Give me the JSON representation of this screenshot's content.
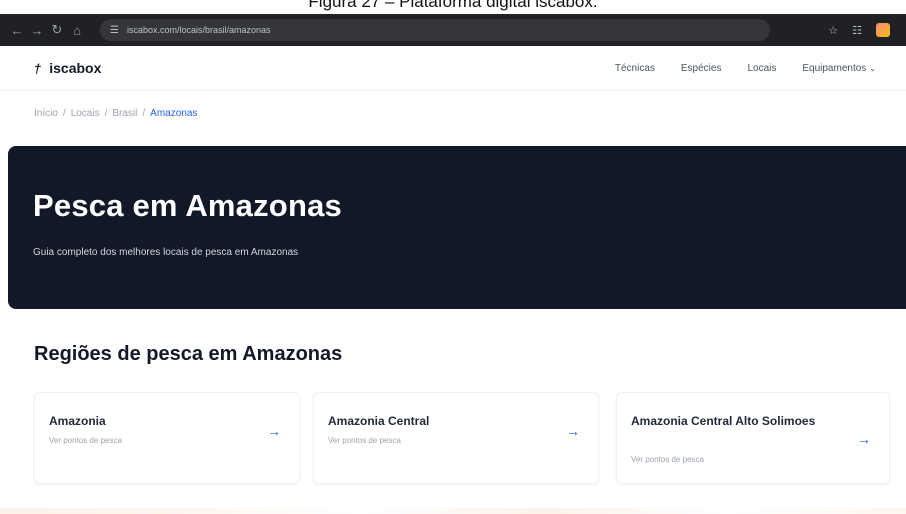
{
  "caption": "Figura 27 – Plataforma digital iscabox.",
  "browser": {
    "nav_icons": [
      "arrow-left",
      "arrow-right",
      "reload",
      "home"
    ],
    "url": "iscabox.com/locais/brasil/amazonas"
  },
  "header": {
    "logo_text": "iscabox",
    "menu": [
      "Técnicas",
      "Espécies",
      "Locais",
      "Equipamentos"
    ]
  },
  "breadcrumb": {
    "items": [
      "Início",
      "Locais",
      "Brasil",
      "Amazonas"
    ],
    "separator": "/"
  },
  "hero": {
    "title": "Pesca em Amazonas",
    "subtitle": "Guia completo dos melhores locais de pesca em Amazonas"
  },
  "regions": {
    "title": "Regiões de pesca em Amazonas",
    "cards": [
      {
        "name": "Amazonia",
        "link_text": "Ver pontos de pesca"
      },
      {
        "name": "Amazonia Central",
        "link_text": "Ver pontos de pesca"
      },
      {
        "name": "Amazonia Central Alto Solimoes",
        "link_text": "Ver pontos de pesca"
      }
    ],
    "arrow": "→"
  },
  "colors": {
    "hero_bg": "#111827",
    "accent": "#2563eb",
    "browser_bg": "#202124"
  }
}
